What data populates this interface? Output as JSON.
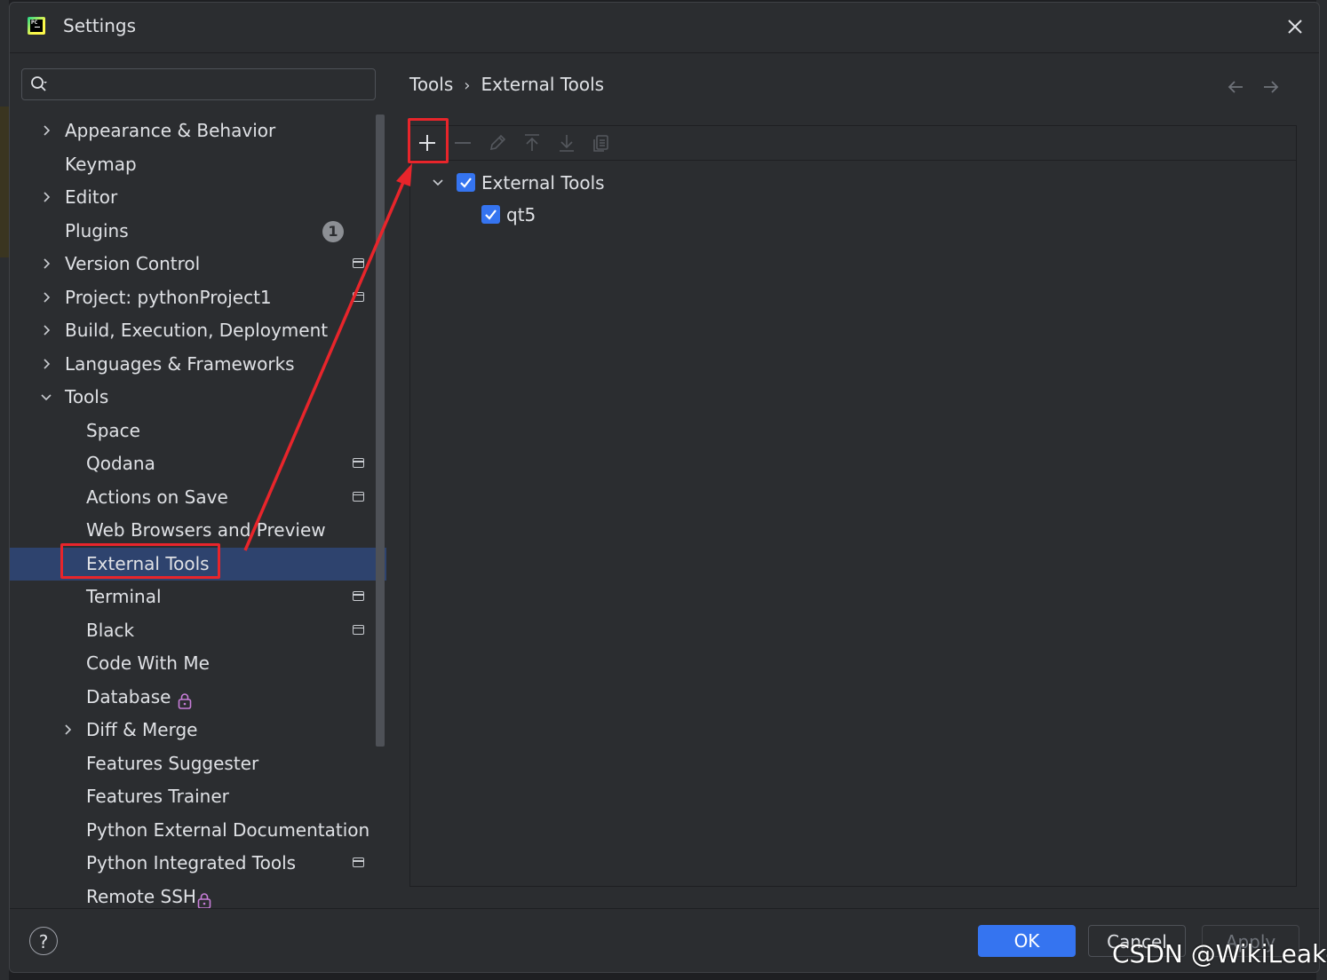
{
  "window": {
    "title": "Settings"
  },
  "search": {
    "placeholder": "",
    "value": ""
  },
  "sidebar": {
    "items": [
      {
        "label": "Appearance & Behavior",
        "expandable": true,
        "expanded": false,
        "level": 0
      },
      {
        "label": "Keymap",
        "expandable": false,
        "level": 0
      },
      {
        "label": "Editor",
        "expandable": true,
        "expanded": false,
        "level": 0
      },
      {
        "label": "Plugins",
        "expandable": false,
        "level": 0,
        "badge": "1"
      },
      {
        "label": "Version Control",
        "expandable": true,
        "expanded": false,
        "level": 0,
        "project_icon": true
      },
      {
        "label": "Project: pythonProject1",
        "expandable": true,
        "expanded": false,
        "level": 0,
        "project_icon": true
      },
      {
        "label": "Build, Execution, Deployment",
        "expandable": true,
        "expanded": false,
        "level": 0
      },
      {
        "label": "Languages & Frameworks",
        "expandable": true,
        "expanded": false,
        "level": 0
      },
      {
        "label": "Tools",
        "expandable": true,
        "expanded": true,
        "level": 0
      },
      {
        "label": "Space",
        "level": 1
      },
      {
        "label": "Qodana",
        "level": 1,
        "project_icon": true
      },
      {
        "label": "Actions on Save",
        "level": 1,
        "project_icon": true
      },
      {
        "label": "Web Browsers and Preview",
        "level": 1
      },
      {
        "label": "External Tools",
        "level": 1,
        "selected": true
      },
      {
        "label": "Terminal",
        "level": 1,
        "project_icon": true
      },
      {
        "label": "Black",
        "level": 1,
        "project_icon": true
      },
      {
        "label": "Code With Me",
        "level": 1
      },
      {
        "label": "Database",
        "level": 1,
        "lock": true
      },
      {
        "label": "Diff & Merge",
        "level": 1,
        "expandable": true,
        "expanded": false
      },
      {
        "label": "Features Suggester",
        "level": 1
      },
      {
        "label": "Features Trainer",
        "level": 1
      },
      {
        "label": "Python External Documentation",
        "level": 1
      },
      {
        "label": "Python Integrated Tools",
        "level": 1,
        "project_icon": true
      },
      {
        "label": "Remote SSH",
        "level": 1,
        "lock": true
      }
    ]
  },
  "breadcrumb": {
    "parent": "Tools",
    "separator": "›",
    "current": "External Tools"
  },
  "toolbar": {
    "buttons": [
      "add-icon",
      "remove-icon",
      "edit-icon",
      "move-up-icon",
      "move-down-icon",
      "copy-icon"
    ]
  },
  "tools_tree": {
    "group": {
      "label": "External Tools",
      "checked": true,
      "expanded": true
    },
    "items": [
      {
        "label": "qt5",
        "checked": true
      }
    ]
  },
  "footer": {
    "help": "?",
    "ok": "OK",
    "cancel": "Cancel",
    "apply": "Apply"
  },
  "watermark": "CSDN @WikiLeake",
  "colors": {
    "accent": "#3574f0",
    "selection": "#2e436e",
    "annotation": "#e8252b",
    "lock": "#c77dd8"
  }
}
